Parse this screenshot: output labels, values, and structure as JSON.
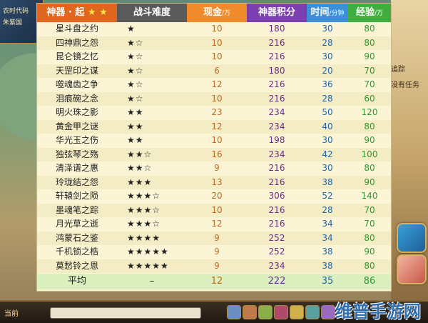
{
  "hud": {
    "line1": "农时代码",
    "line2": "朱紫国"
  },
  "right_panel": {
    "line1": "追踪",
    "line2": "没有任务"
  },
  "bottom": {
    "chat_tag": "当前",
    "watermark": "维普手游网"
  },
  "table": {
    "header": {
      "col1_label": "神器 · 起",
      "col1_stars": "★ ★",
      "col2_label": "战斗难度",
      "col3_label": "现金",
      "col3_unit": "/万",
      "col4_label": "神器积分",
      "col5_label": "时间",
      "col5_unit": "/分钟",
      "col6_label": "经验",
      "col6_unit": "/万"
    },
    "colors": {
      "col1": "#e0661e",
      "col2": "#5a5a5a",
      "col3": "#f08a2a",
      "col4": "#7b3fb0",
      "col5": "#3d8fd8",
      "col6": "#3fae3f"
    },
    "rows": [
      {
        "name": "星斗盘之约",
        "difficulty": "★",
        "cash": "10",
        "points": "180",
        "time": "30",
        "exp": "80"
      },
      {
        "name": "四神鼎之怨",
        "difficulty": "★☆",
        "cash": "10",
        "points": "216",
        "time": "28",
        "exp": "80"
      },
      {
        "name": "昆仑镜之忆",
        "difficulty": "★☆",
        "cash": "10",
        "points": "216",
        "time": "30",
        "exp": "90"
      },
      {
        "name": "天罡印之谋",
        "difficulty": "★☆",
        "cash": "6",
        "points": "180",
        "time": "20",
        "exp": "70"
      },
      {
        "name": "噬魂齿之争",
        "difficulty": "★☆",
        "cash": "12",
        "points": "216",
        "time": "36",
        "exp": "70"
      },
      {
        "name": "泪痕碗之念",
        "difficulty": "★☆",
        "cash": "10",
        "points": "216",
        "time": "28",
        "exp": "60"
      },
      {
        "name": "明火珠之影",
        "difficulty": "★★",
        "cash": "23",
        "points": "234",
        "time": "50",
        "exp": "120"
      },
      {
        "name": "黄金甲之谜",
        "difficulty": "★★",
        "cash": "12",
        "points": "234",
        "time": "40",
        "exp": "80"
      },
      {
        "name": "华光玉之伤",
        "difficulty": "★★",
        "cash": "10",
        "points": "198",
        "time": "30",
        "exp": "90"
      },
      {
        "name": "独弦琴之殇",
        "difficulty": "★★☆",
        "cash": "16",
        "points": "234",
        "time": "42",
        "exp": "100"
      },
      {
        "name": "清泽谱之惠",
        "difficulty": "★★☆",
        "cash": "9",
        "points": "216",
        "time": "30",
        "exp": "80"
      },
      {
        "name": "玲珑结之怨",
        "difficulty": "★★★",
        "cash": "13",
        "points": "216",
        "time": "38",
        "exp": "90"
      },
      {
        "name": "轩辕剑之陨",
        "difficulty": "★★★☆",
        "cash": "20",
        "points": "306",
        "time": "52",
        "exp": "140"
      },
      {
        "name": "墨魂笔之踪",
        "difficulty": "★★★☆",
        "cash": "10",
        "points": "216",
        "time": "28",
        "exp": "70"
      },
      {
        "name": "月光草之逝",
        "difficulty": "★★★☆",
        "cash": "12",
        "points": "216",
        "time": "34",
        "exp": "70"
      },
      {
        "name": "鸿蒙石之鉴",
        "difficulty": "★★★★",
        "cash": "9",
        "points": "252",
        "time": "34",
        "exp": "80"
      },
      {
        "name": "千机锁之梏",
        "difficulty": "★★★★★",
        "cash": "9",
        "points": "252",
        "time": "38",
        "exp": "90"
      },
      {
        "name": "莫愁铃之恩",
        "difficulty": "★★★★★",
        "cash": "9",
        "points": "234",
        "time": "38",
        "exp": "80"
      }
    ],
    "average": {
      "label": "平均",
      "difficulty": "–",
      "cash": "12",
      "points": "222",
      "time": "35",
      "exp": "86"
    }
  }
}
